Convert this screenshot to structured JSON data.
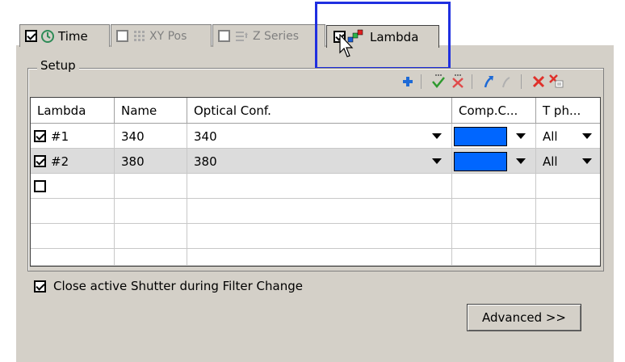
{
  "tabs": [
    {
      "label": "Time",
      "checked": true,
      "icon": "clock-icon",
      "enabled": true
    },
    {
      "label": "XY Pos",
      "checked": false,
      "icon": "grid-icon",
      "enabled": false
    },
    {
      "label": "Z Series",
      "checked": false,
      "icon": "z-stack-icon",
      "enabled": false
    },
    {
      "label": "Lambda",
      "checked": true,
      "icon": "lambda-icon",
      "enabled": true,
      "active": true
    }
  ],
  "setup": {
    "title": "Setup",
    "toolbar": [
      "add-icon",
      "check-all-icon",
      "uncheck-all-icon",
      "move-up-icon",
      "move-down-icon",
      "delete-icon",
      "delete-all-icon"
    ]
  },
  "grid": {
    "headers": [
      "Lambda",
      "Name",
      "Optical Conf.",
      "Comp.C...",
      "T ph..."
    ],
    "rows": [
      {
        "checked": true,
        "lambda": "#1",
        "name": "340",
        "optical": "340",
        "color": "#0066ff",
        "tph": "All"
      },
      {
        "checked": true,
        "lambda": "#2",
        "name": "380",
        "optical": "380",
        "color": "#0066ff",
        "tph": "All"
      },
      {
        "checked": false,
        "lambda": "",
        "name": "",
        "optical": "",
        "color": "",
        "tph": ""
      }
    ]
  },
  "close_shutter": {
    "label": "Close active Shutter during Filter Change",
    "checked": true
  },
  "advanced_button": "Advanced >>",
  "colors": {
    "highlight_box": "#1f2fe0",
    "swatch": "#0066ff",
    "dialog_bg": "#d4d0c8"
  }
}
